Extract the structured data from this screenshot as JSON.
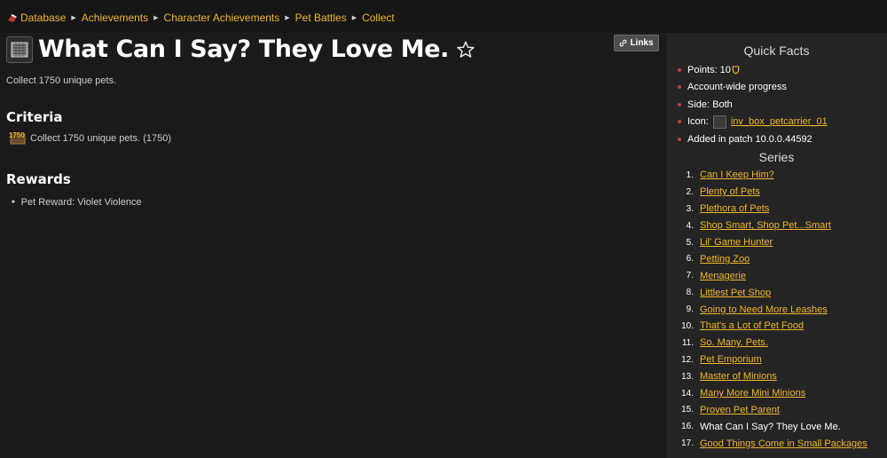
{
  "breadcrumb": [
    "Database",
    "Achievements",
    "Character Achievements",
    "Pet Battles",
    "Collect"
  ],
  "title": "What Can I Say? They Love Me.",
  "description": "Collect 1750 unique pets.",
  "links_label": "Links",
  "criteria": {
    "heading": "Criteria",
    "icon_count": "1750",
    "text": "Collect 1750 unique pets. (1750)"
  },
  "rewards": {
    "heading": "Rewards",
    "items": [
      "Pet Reward: Violet Violence"
    ]
  },
  "quick_facts": {
    "heading": "Quick Facts",
    "points": "Points: 10",
    "account": "Account-wide progress",
    "side": "Side: Both",
    "icon_label": "Icon:",
    "icon_name": "inv_box_petcarrier_01",
    "added": "Added in patch 10.0.0.44592"
  },
  "series": {
    "heading": "Series",
    "items": [
      {
        "n": "1.",
        "t": "Can I Keep Him?"
      },
      {
        "n": "2.",
        "t": "Plenty of Pets"
      },
      {
        "n": "3.",
        "t": "Plethora of Pets"
      },
      {
        "n": "4.",
        "t": "Shop Smart, Shop Pet...Smart"
      },
      {
        "n": "5.",
        "t": "Lil' Game Hunter"
      },
      {
        "n": "6.",
        "t": "Petting Zoo"
      },
      {
        "n": "7.",
        "t": "Menagerie"
      },
      {
        "n": "8.",
        "t": "Littlest Pet Shop"
      },
      {
        "n": "9.",
        "t": "Going to Need More Leashes"
      },
      {
        "n": "10.",
        "t": "That's a Lot of Pet Food"
      },
      {
        "n": "11.",
        "t": "So. Many. Pets."
      },
      {
        "n": "12.",
        "t": "Pet Emporium"
      },
      {
        "n": "13.",
        "t": "Master of Minions"
      },
      {
        "n": "14.",
        "t": "Many More Mini Minions"
      },
      {
        "n": "15.",
        "t": "Proven Pet Parent"
      },
      {
        "n": "16.",
        "t": "What Can I Say? They Love Me."
      },
      {
        "n": "17.",
        "t": "Good Things Come in Small Packages"
      }
    ]
  },
  "colors": {
    "link": "#f0b72a",
    "bullet": "#c43c3c",
    "background": "#181818",
    "sidebar": "#242424"
  }
}
